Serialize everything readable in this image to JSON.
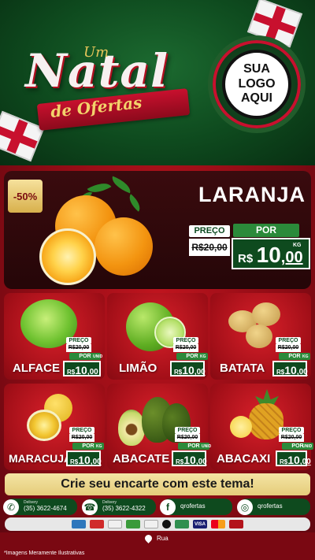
{
  "header": {
    "title_um": "Um",
    "title_natal": "Natal",
    "title_ofertas": "de Ofertas",
    "logo_text": "SUA LOGO AQUI"
  },
  "featured": {
    "discount": "-50%",
    "name": "LARANJA",
    "preco_label": "PREÇO",
    "old_price": "R$20,00",
    "por_label": "POR",
    "currency": "R$",
    "price_int": "10",
    "price_cents": ",00",
    "unit": "KG"
  },
  "products": [
    {
      "name": "ALFACE",
      "preco_label": "PREÇO",
      "old_price": "R$20,00",
      "por_label": "POR",
      "currency": "R$",
      "price_int": "10",
      "price_cents": ",00",
      "unit": "UNID"
    },
    {
      "name": "LIMÃO",
      "preco_label": "PREÇO",
      "old_price": "R$20,00",
      "por_label": "POR",
      "currency": "R$",
      "price_int": "10",
      "price_cents": ",00",
      "unit": "KG"
    },
    {
      "name": "BATATA",
      "preco_label": "PREÇO",
      "old_price": "R$20,00",
      "por_label": "POR",
      "currency": "R$",
      "price_int": "10",
      "price_cents": ",00",
      "unit": "KG"
    },
    {
      "name": "MARACUJÁ",
      "preco_label": "PREÇO",
      "old_price": "R$20,00",
      "por_label": "POR",
      "currency": "R$",
      "price_int": "10",
      "price_cents": ",00",
      "unit": "KG"
    },
    {
      "name": "ABACATE",
      "preco_label": "PREÇO",
      "old_price": "R$20,00",
      "por_label": "POR",
      "currency": "R$",
      "price_int": "10",
      "price_cents": ",00",
      "unit": "UNID"
    },
    {
      "name": "ABACAXI",
      "preco_label": "PREÇO",
      "old_price": "R$20,00",
      "por_label": "POR",
      "currency": "R$",
      "price_int": "10",
      "price_cents": ",00",
      "unit": "UNID"
    }
  ],
  "cta": "Crie seu encarte com este tema!",
  "contacts": {
    "whatsapp_label": "Delivery",
    "whatsapp_phone": "(35) 3622-4674",
    "phone_label": "Delivery",
    "phone_phone": "(35) 3622-4322",
    "facebook": "qrofertas",
    "instagram": "qrofertas"
  },
  "payments": [
    "amex",
    "cartão",
    "débito",
    "ticket",
    "alimentação",
    "elo",
    "ticket2",
    "VISA",
    "mastercard",
    "hipercard"
  ],
  "colors": {
    "green_dark": "#0e4a1e",
    "green": "#2b8a3a",
    "red": "#c0141e",
    "gold": "#e5cc7a"
  },
  "location": "Rua",
  "disclaimer": "*Imagens Meramente Ilustrativas"
}
